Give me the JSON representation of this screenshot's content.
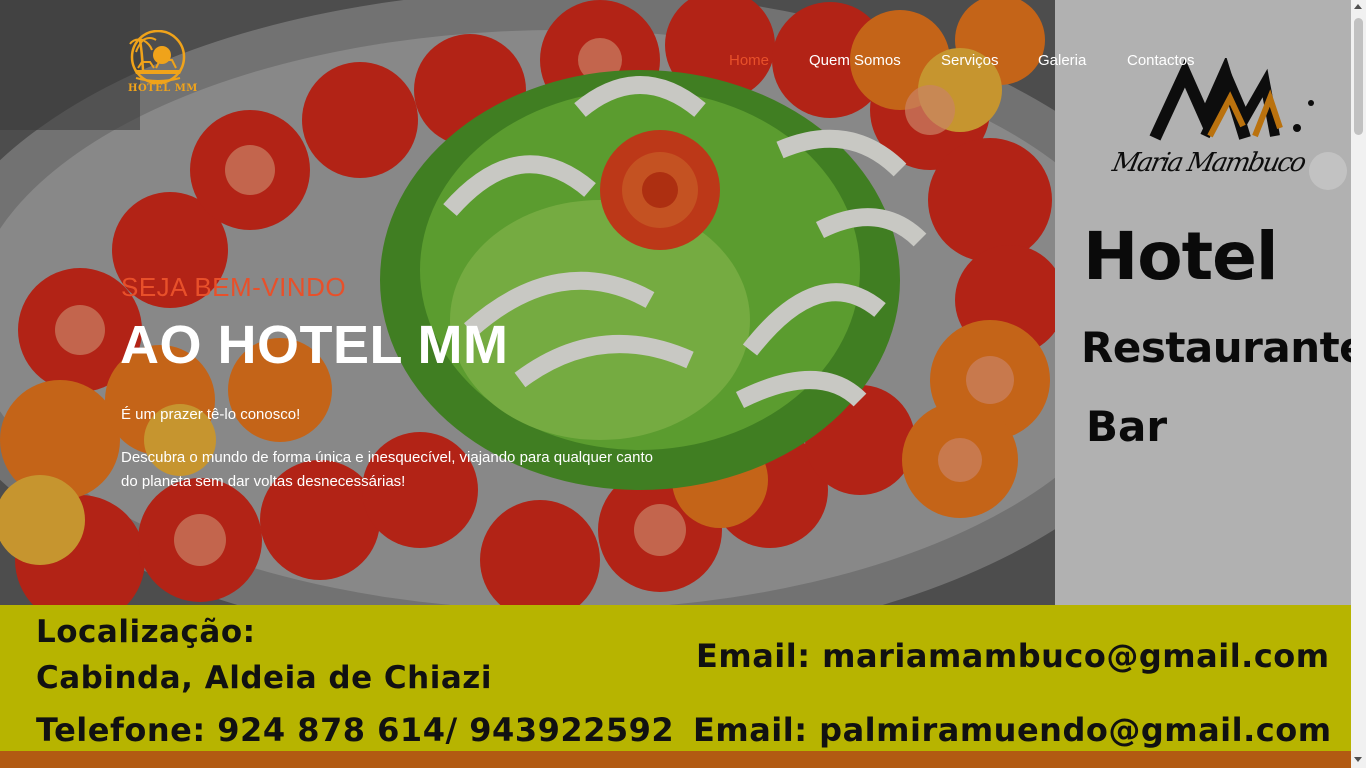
{
  "header": {
    "logo_text": "HOTEL MM",
    "nav": [
      {
        "label": "Home",
        "active": true
      },
      {
        "label": "Quem Somos",
        "active": false
      },
      {
        "label": "Serviços",
        "active": false
      },
      {
        "label": "Galeria",
        "active": false
      },
      {
        "label": "Contactos",
        "active": false
      }
    ]
  },
  "hero": {
    "welcome": "SEJA BEM-VINDO",
    "headline": "AO HOTEL MM",
    "paragraph1": "É um prazer tê-lo conosco!",
    "paragraph2": "Descubra o mundo de forma única e inesquecível, viajando para qualquer canto do planeta sem dar voltas desnecessárias!"
  },
  "promo": {
    "script": "Maria Mambuco",
    "hotel": "Hotel",
    "restaurante": "Restaurante",
    "bar": "Bar"
  },
  "contact_band": {
    "location_label": "Localização:",
    "location_value": "Cabinda, Aldeia de Chiazi",
    "phone": "Telefone: 924 878 614/ 943922592",
    "email1": "Email: mariamambuco@gmail.com",
    "email2": "Email: palmiramuendo@gmail.com"
  },
  "colors": {
    "accent": "#e8502a",
    "logo_gold": "#f0a31a",
    "band_yellow": "#b7b400",
    "band_brown": "#b25a12"
  }
}
